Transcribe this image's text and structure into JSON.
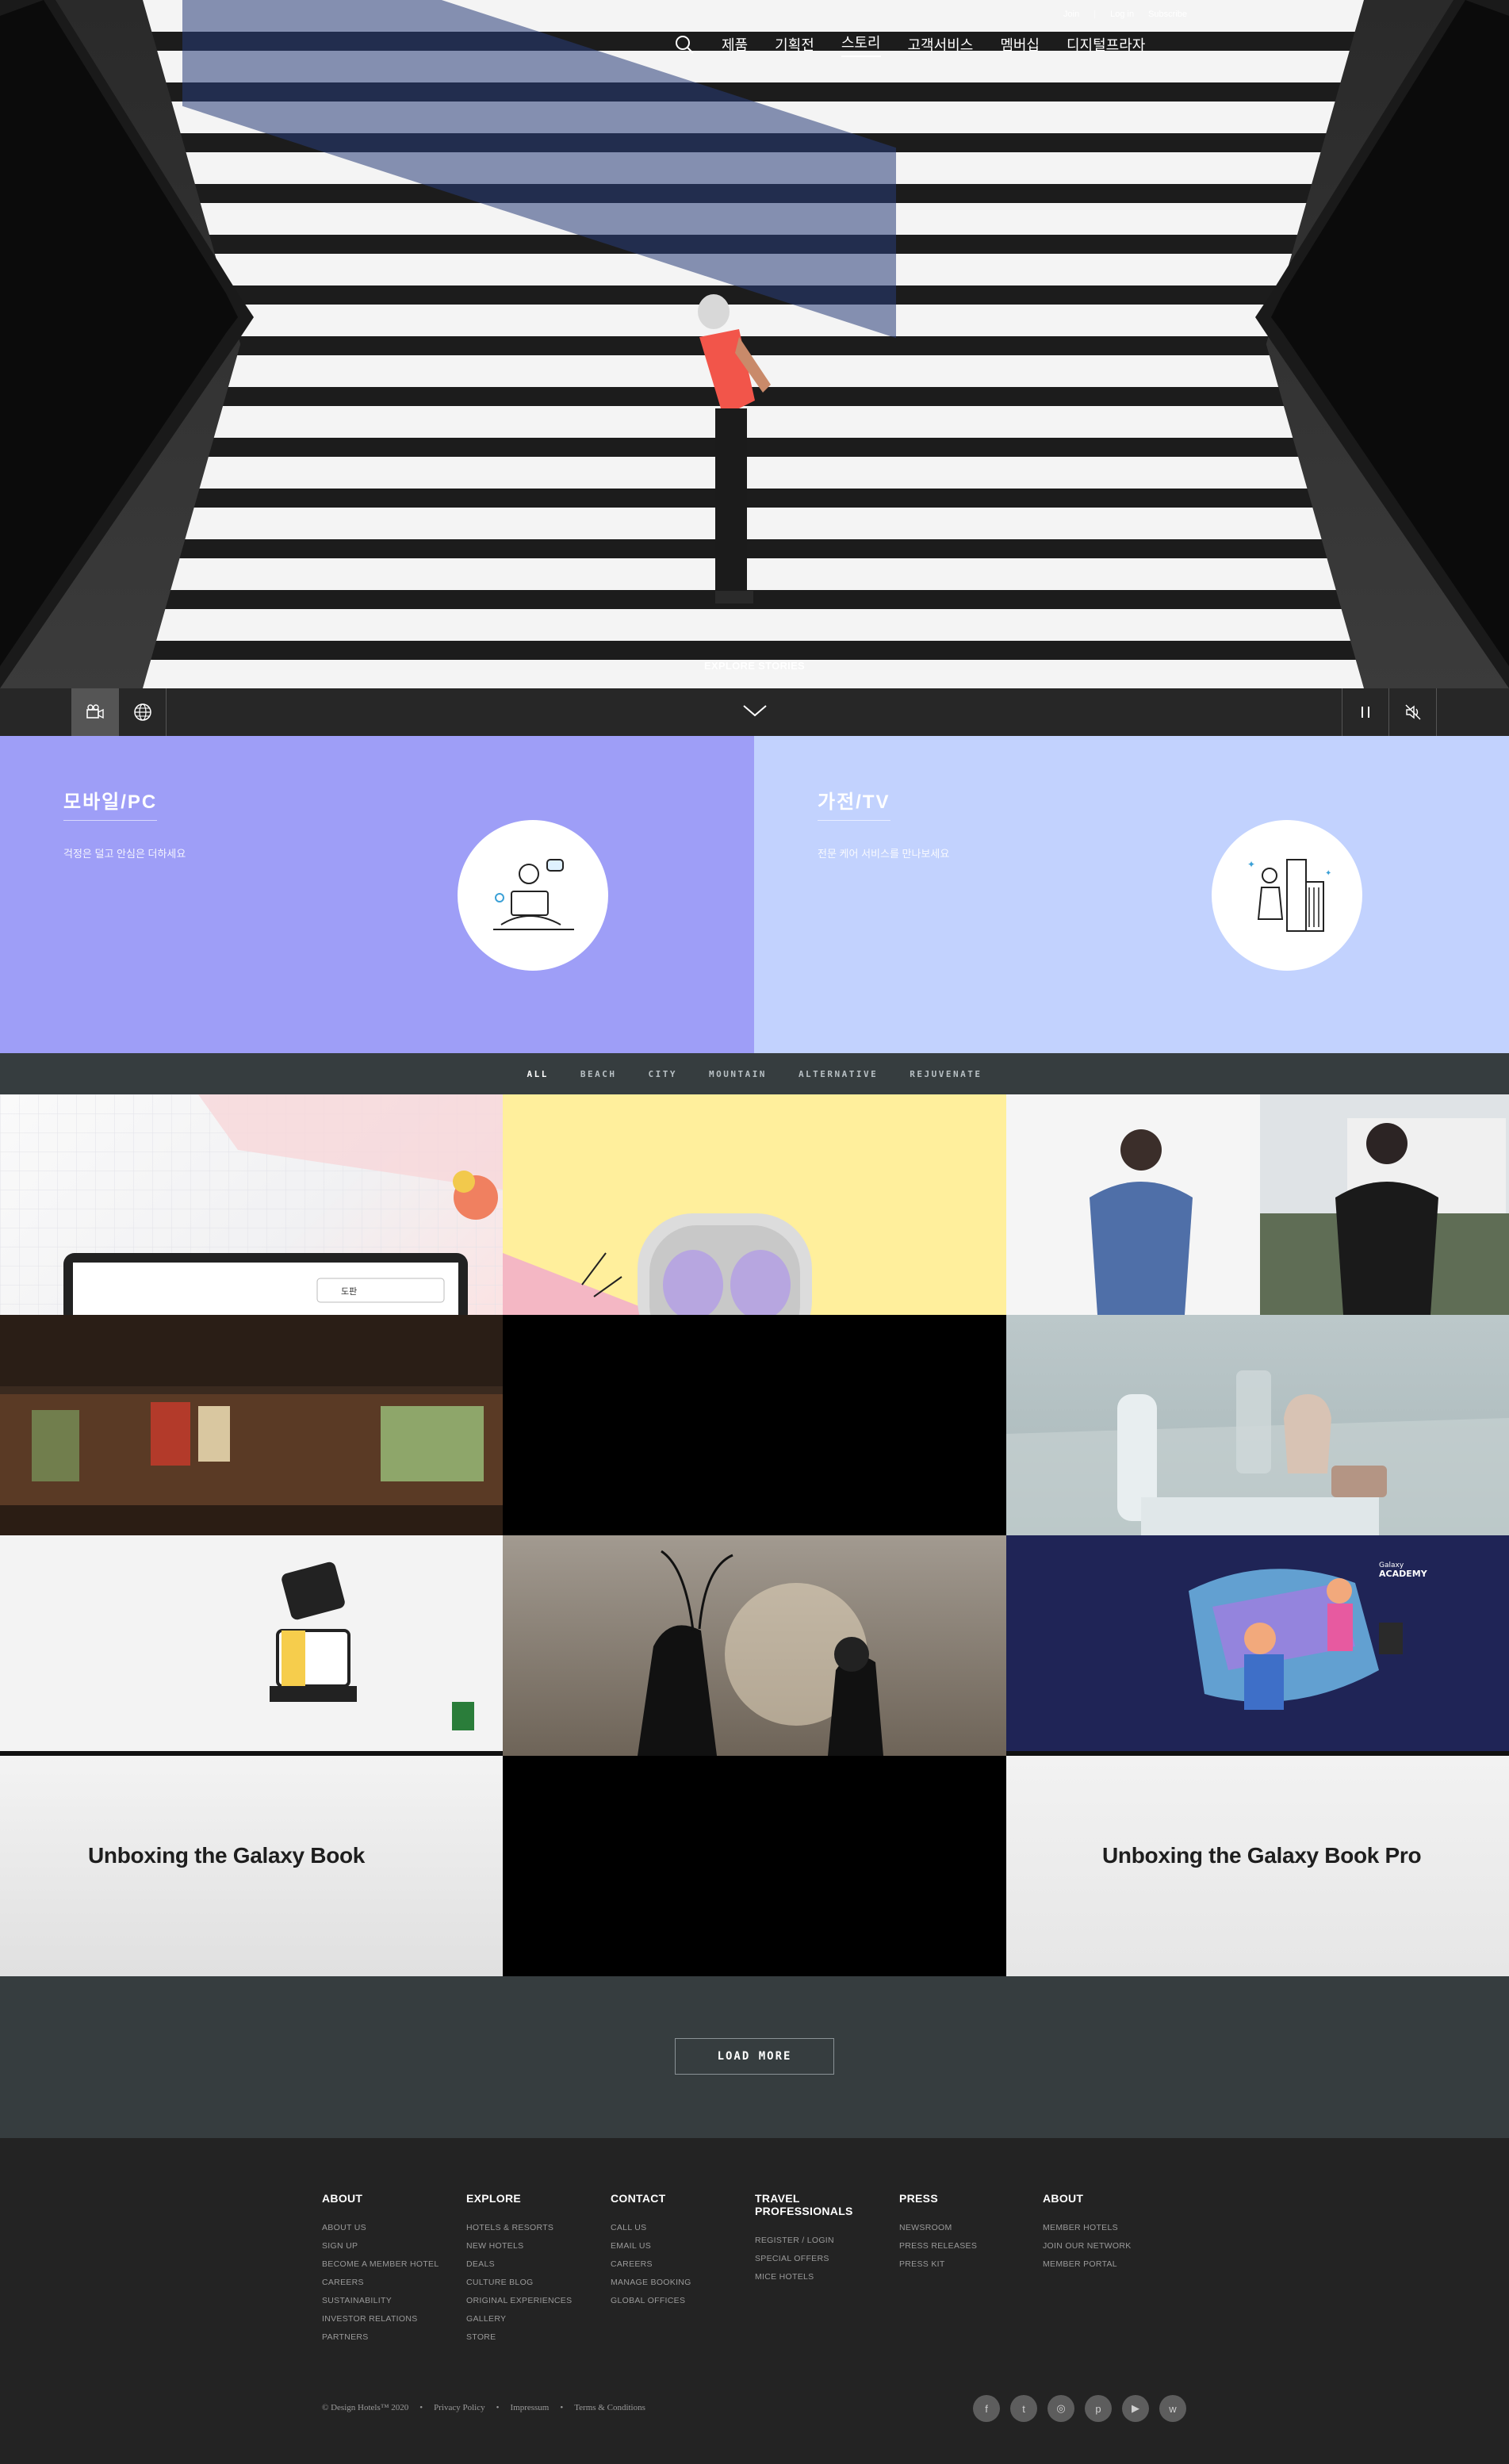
{
  "header": {
    "utility": [
      "Join",
      "Log in",
      "Subscribe"
    ],
    "nav": [
      {
        "label": "제품",
        "active": false
      },
      {
        "label": "기획전",
        "active": false
      },
      {
        "label": "스토리",
        "active": true
      },
      {
        "label": "고객서비스",
        "active": false
      },
      {
        "label": "멤버십",
        "active": false
      },
      {
        "label": "디지털프라자",
        "active": false
      }
    ],
    "icons": {
      "search": "search-icon"
    }
  },
  "hero": {
    "cta": "EXPLORE STORIES",
    "controls": {
      "left": [
        "video-camera-icon",
        "globe-icon"
      ],
      "center": "chevron-down-icon",
      "right": [
        "pause-icon",
        "mute-icon"
      ]
    }
  },
  "services": [
    {
      "title": "모바일/PC",
      "desc": "걱정은 덜고 안심은 더하세요",
      "color": "#9e9ef7"
    },
    {
      "title": "가전/TV",
      "desc": "전문 케어 서비스를 만나보세요",
      "color": "#c2d2fe"
    }
  ],
  "filters": [
    "ALL",
    "BEACH",
    "CITY",
    "MOUNTAIN",
    "ALTERNATIVE",
    "REJUVENATE"
  ],
  "tiles": {
    "galaxy_book": "Unboxing the Galaxy Book",
    "galaxy_book_pro": "Unboxing the Galaxy Book Pro",
    "tab_ui_label": "도판",
    "academy_badge_1": "Galaxy",
    "academy_badge_2": "ACADEMY"
  },
  "load_more": "LOAD MORE",
  "footer": {
    "columns": [
      {
        "heading": "ABOUT",
        "links": [
          "ABOUT US",
          "SIGN UP",
          "BECOME A MEMBER HOTEL",
          "CAREERS",
          "SUSTAINABILITY",
          "INVESTOR RELATIONS",
          "PARTNERS"
        ]
      },
      {
        "heading": "EXPLORE",
        "links": [
          "HOTELS & RESORTS",
          "NEW HOTELS",
          "DEALS",
          "CULTURE BLOG",
          "ORIGINAL EXPERIENCES",
          "GALLERY",
          "STORE"
        ]
      },
      {
        "heading": "CONTACT",
        "links": [
          "CALL US",
          "EMAIL US",
          "CAREERS",
          "MANAGE BOOKING",
          "GLOBAL OFFICES"
        ]
      },
      {
        "heading": "TRAVEL PROFESSIONALS",
        "links": [
          "REGISTER / LOGIN",
          "SPECIAL OFFERS",
          "MICE HOTELS"
        ]
      },
      {
        "heading": "PRESS",
        "links": [
          "NEWSROOM",
          "PRESS RELEASES",
          "PRESS KIT"
        ]
      },
      {
        "heading": "ABOUT",
        "links": [
          "MEMBER HOTELS",
          "JOIN OUR NETWORK",
          "MEMBER PORTAL"
        ]
      }
    ],
    "copyright": "© Design Hotels™ 2020",
    "legal": [
      "Privacy Policy",
      "Impressum",
      "Terms & Conditions"
    ],
    "separator": "•",
    "socials": [
      "facebook-icon",
      "twitter-icon",
      "instagram-icon",
      "pinterest-icon",
      "youtube-icon",
      "wechat-icon"
    ],
    "social_glyphs": [
      "f",
      "t",
      "◎",
      "p",
      "▶",
      "w"
    ]
  }
}
